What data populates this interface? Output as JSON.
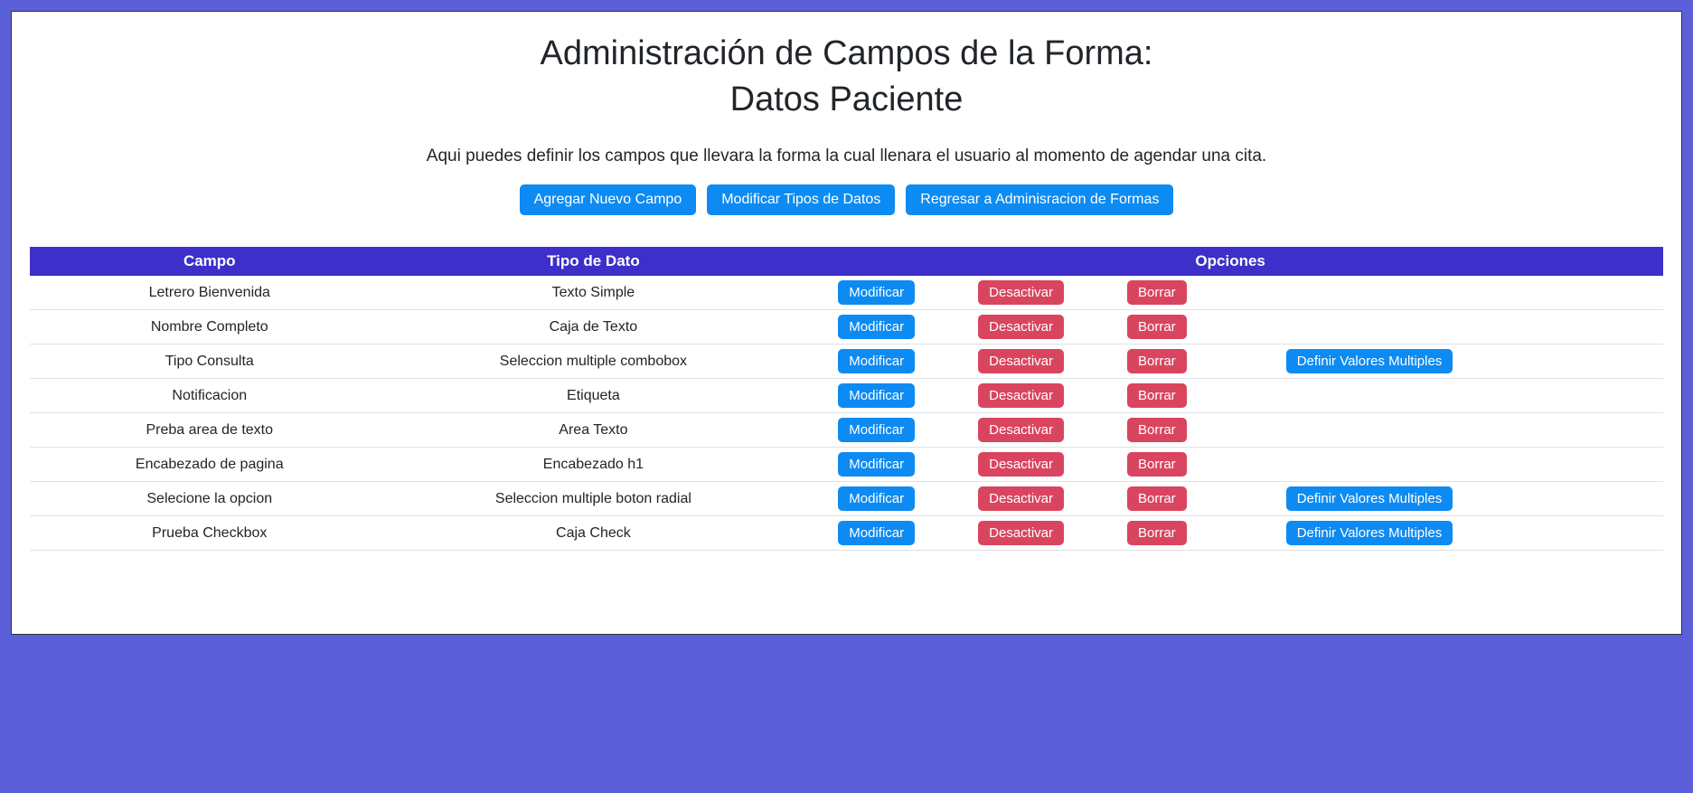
{
  "header": {
    "title_line1": "Administración de Campos de la Forma:",
    "title_line2": "Datos Paciente",
    "description": "Aqui puedes definir los campos que llevara la forma la cual llenara el usuario al momento de agendar una cita."
  },
  "top_buttons": {
    "add_field": "Agregar Nuevo Campo",
    "modify_types": "Modificar Tipos de Datos",
    "return_admin": "Regresar a Adminisracion de Formas"
  },
  "table": {
    "headers": {
      "campo": "Campo",
      "tipo": "Tipo de Dato",
      "opciones": "Opciones"
    },
    "actions": {
      "modify": "Modificar",
      "deactivate": "Desactivar",
      "delete": "Borrar",
      "define_multiple": "Definir Valores Multiples"
    },
    "rows": [
      {
        "campo": "Letrero Bienvenida",
        "tipo": "Texto Simple",
        "has_multiple": false
      },
      {
        "campo": "Nombre Completo",
        "tipo": "Caja de Texto",
        "has_multiple": false
      },
      {
        "campo": "Tipo Consulta",
        "tipo": "Seleccion multiple combobox",
        "has_multiple": true
      },
      {
        "campo": "Notificacion",
        "tipo": "Etiqueta",
        "has_multiple": false
      },
      {
        "campo": "Preba area de texto",
        "tipo": "Area Texto",
        "has_multiple": false
      },
      {
        "campo": "Encabezado de pagina",
        "tipo": "Encabezado h1",
        "has_multiple": false
      },
      {
        "campo": "Selecione la opcion",
        "tipo": "Seleccion multiple boton radial",
        "has_multiple": true
      },
      {
        "campo": "Prueba Checkbox",
        "tipo": "Caja Check",
        "has_multiple": true
      }
    ]
  }
}
